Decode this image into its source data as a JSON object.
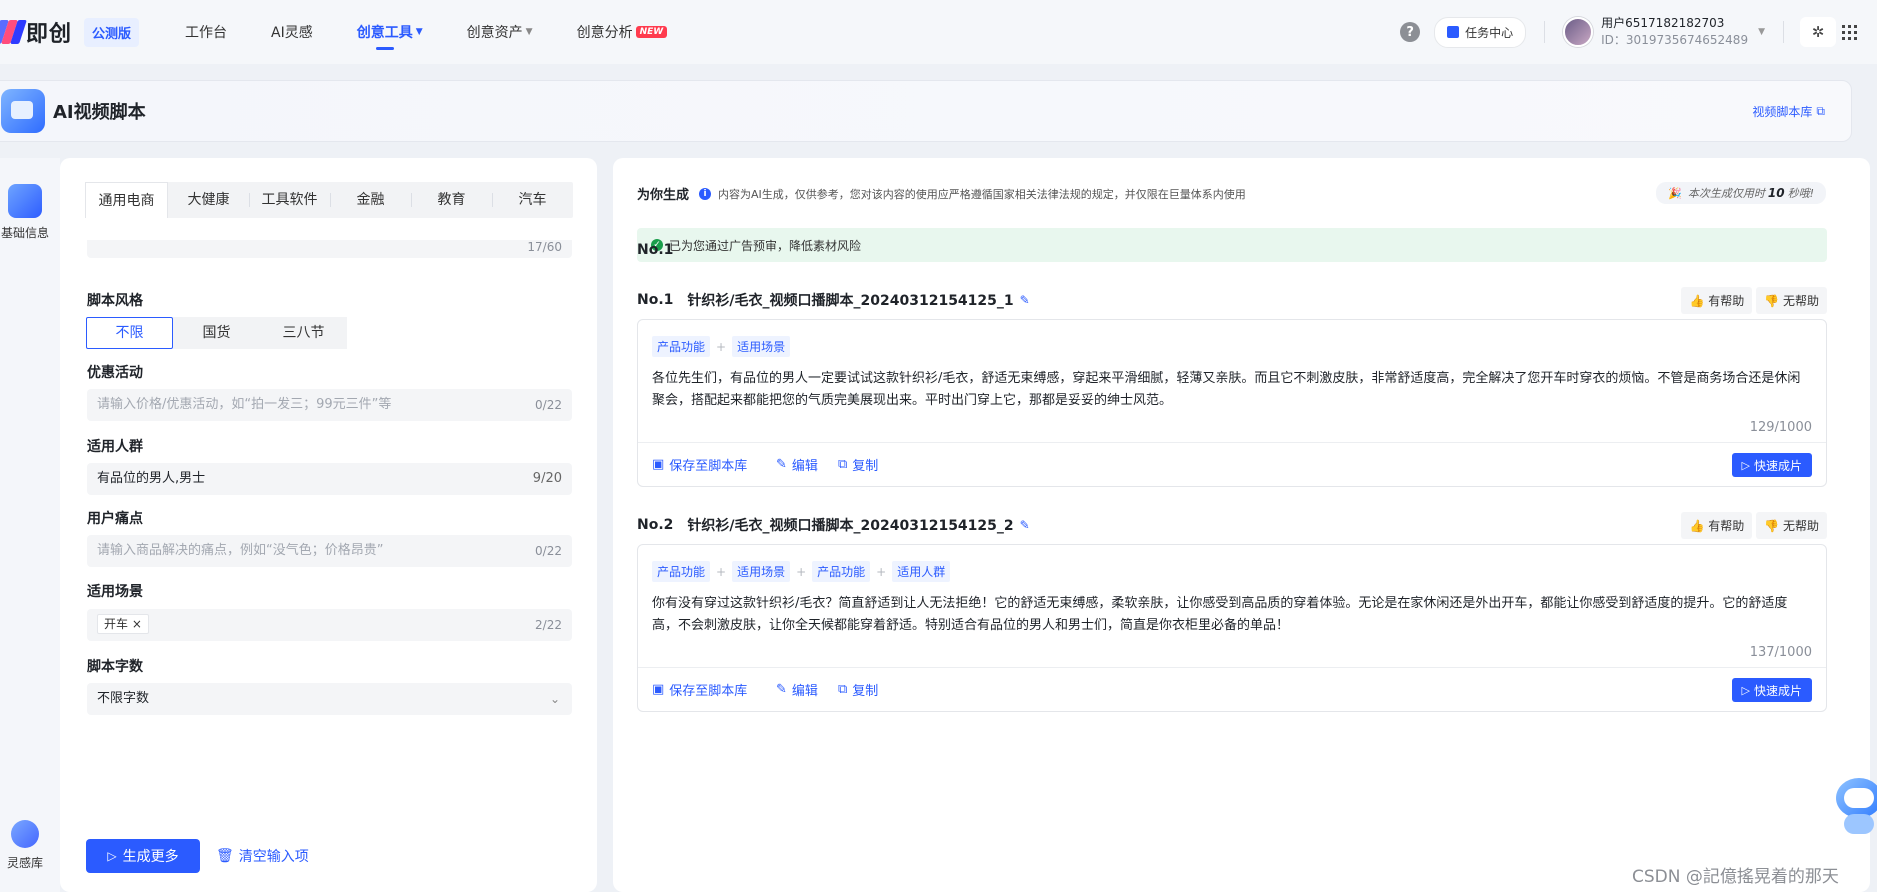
{
  "app": {
    "logo_text": "即创",
    "beta_label": "公测版"
  },
  "nav": {
    "items": [
      {
        "label": "工作台"
      },
      {
        "label": "AI灵感"
      },
      {
        "label": "创意工具"
      },
      {
        "label": "创意资产"
      },
      {
        "label": "创意分析",
        "badge": "NEW"
      }
    ],
    "active": "创意工具"
  },
  "topright": {
    "help": "?",
    "task_center": "任务中心",
    "user_name": "用户6517182182703",
    "user_id": "ID：3019735674652489"
  },
  "header": {
    "title": "AI视频脚本",
    "library_link": "视频脚本库"
  },
  "rail": {
    "items": [
      {
        "label": "基础信息"
      },
      {
        "label": "灵感库"
      }
    ]
  },
  "form": {
    "tabs": [
      "通用电商",
      "大健康",
      "工具软件",
      "金融",
      "教育",
      "汽车"
    ],
    "active_tab": "通用电商",
    "partial_counter": "17/60",
    "style": {
      "label": "脚本风格",
      "options": [
        "不限",
        "国货",
        "三八节"
      ],
      "selected": "不限"
    },
    "promo": {
      "label": "优惠活动",
      "placeholder": "请输入价格/优惠活动，如“拍一发三；99元三件”等",
      "counter": "0/22"
    },
    "audience": {
      "label": "适用人群",
      "value": "有品位的男人,男士",
      "counter": "9/20"
    },
    "pain": {
      "label": "用户痛点",
      "placeholder": "请输入商品解决的痛点，例如“没气色；价格昂贵”",
      "counter": "0/22"
    },
    "scene": {
      "label": "适用场景",
      "tag": "开车 ×",
      "counter": "2/22"
    },
    "wordcount": {
      "label": "脚本字数",
      "value": "不限字数"
    },
    "generate_button": "生成更多",
    "clear_button": "清空输入项"
  },
  "results": {
    "title": "为你生成",
    "note": "内容为AI生成，仅供参考，您对该内容的使用应严格遵循国家相关法律法规的规定，并仅限在巨量体系内使用",
    "timer_prefix": "本次生成仅用时",
    "timer_value": "10",
    "timer_suffix": "秒哦!",
    "risk_text": "已为您通过广告预审，降低素材风险",
    "helpful": "有帮助",
    "unhelpful": "无帮助",
    "save_label": "保存至脚本库",
    "edit_label": "编辑",
    "copy_label": "复制",
    "quick_label": "快速成片",
    "scripts": [
      {
        "no": "No.1",
        "name": "针织衫/毛衣_视频口播脚本_20240312154125_1",
        "tags": [
          "产品功能",
          "适用场景"
        ],
        "text": "各位先生们，有品位的男人一定要试试这款针织衫/毛衣，舒适无束缚感，穿起来平滑细腻，轻薄又亲肤。而且它不刺激皮肤，非常舒适度高，完全解决了您开车时穿衣的烦恼。不管是商务场合还是休闲聚会，搭配起来都能把您的气质完美展现出来。平时出门穿上它，那都是妥妥的绅士风范。",
        "counter": "129/1000"
      },
      {
        "no": "No.2",
        "name": "针织衫/毛衣_视频口播脚本_20240312154125_2",
        "tags": [
          "产品功能",
          "适用场景",
          "产品功能",
          "适用人群"
        ],
        "text": "你有没有穿过这款针织衫/毛衣？简直舒适到让人无法拒绝！它的舒适无束缚感，柔软亲肤，让你感受到高品质的穿着体验。无论是在家休闲还是外出开车，都能让你感受到舒适度的提升。它的舒适度高，不会刺激皮肤，让你全天候都能穿着舒适。特别适合有品位的男人和男士们，简直是你衣柜里必备的单品！",
        "counter": "137/1000"
      }
    ]
  },
  "watermark": "CSDN @記億搖晃着的那天"
}
